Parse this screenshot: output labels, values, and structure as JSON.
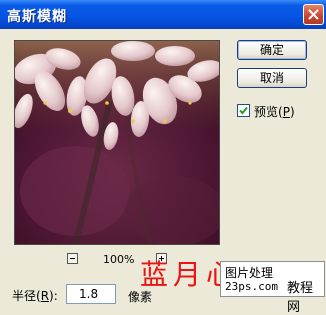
{
  "window": {
    "title": "高斯模糊"
  },
  "preview": {
    "zoom": "100%"
  },
  "buttons": {
    "ok": "确定",
    "cancel": "取消"
  },
  "preview_toggle": {
    "label_prefix": "预览(",
    "mnemonic": "P",
    "label_suffix": ")",
    "checked": true
  },
  "radius": {
    "label_prefix": "半径(",
    "mnemonic": "R",
    "label_suffix": "):",
    "value": "1.8",
    "unit": "像素"
  },
  "watermarks": {
    "text_red": "蓝月心",
    "box_line1": "图片处理",
    "box_line2": "23ps.com",
    "box_line3": "教程网"
  },
  "colors": {
    "titlebar": "#0554e3",
    "dialog_bg": "#ece9d8",
    "watermark_red": "#ea1414"
  }
}
